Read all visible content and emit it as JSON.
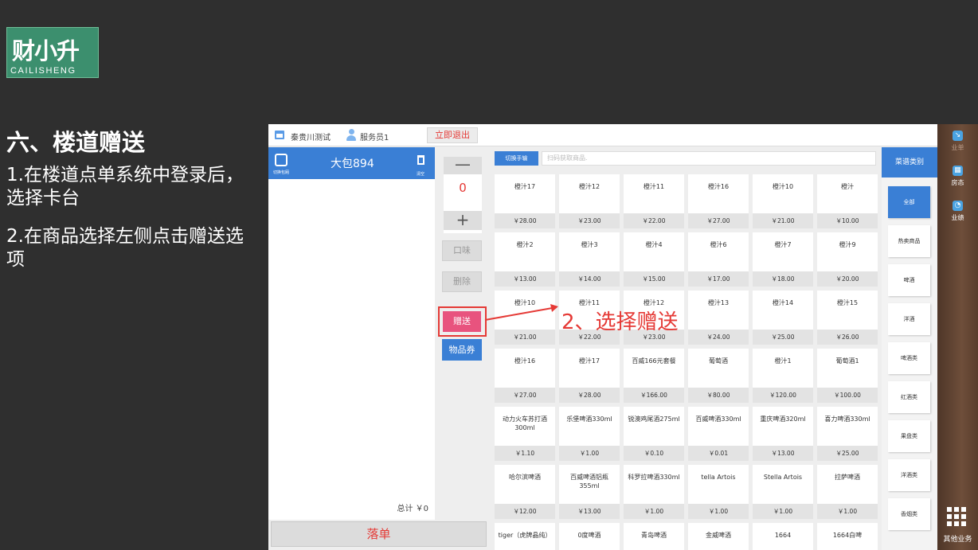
{
  "logo": {
    "cn": "财小升",
    "en": "CAILISHENG"
  },
  "slide": {
    "section_title": "六、楼道赠送",
    "step1": "1.在楼道点单系统中登录后，选择卡台",
    "step2": "2.在商品选择左侧点击赠送选项"
  },
  "app": {
    "store": "秦贵川测试",
    "waiter": "服务员1",
    "logout": "立即退出",
    "switch_table": "切换包厢",
    "table_name": "大包894",
    "clear": "清空",
    "total": "总计 ￥0",
    "place_order": "落单",
    "qty_minus": "—",
    "qty_value": "0",
    "qty_plus": "+",
    "taste": "口味",
    "delete": "删除",
    "gift": "赠送",
    "voucher": "物品券",
    "hand_mode": "切换手输",
    "search_placeholder": "扫码获取商品.",
    "annotation": "2、选择赠送",
    "category_header": "菜谱类别",
    "categories": [
      "全部",
      "热卖商品",
      "啤酒",
      "洋酒",
      "啤酒类",
      "红酒类",
      "果盘类",
      "洋酒类",
      "香烟类"
    ],
    "products": [
      {
        "name": "橙汁17",
        "price": "￥28.00"
      },
      {
        "name": "橙汁12",
        "price": "￥23.00"
      },
      {
        "name": "橙汁11",
        "price": "￥22.00"
      },
      {
        "name": "橙汁16",
        "price": "￥27.00"
      },
      {
        "name": "橙汁10",
        "price": "￥21.00"
      },
      {
        "name": "橙汁",
        "price": "￥10.00"
      },
      {
        "name": "橙汁2",
        "price": "￥13.00"
      },
      {
        "name": "橙汁3",
        "price": "￥14.00"
      },
      {
        "name": "橙汁4",
        "price": "￥15.00"
      },
      {
        "name": "橙汁6",
        "price": "￥17.00"
      },
      {
        "name": "橙汁7",
        "price": "￥18.00"
      },
      {
        "name": "橙汁9",
        "price": "￥20.00"
      },
      {
        "name": "橙汁10",
        "price": "￥21.00"
      },
      {
        "name": "橙汁11",
        "price": "￥22.00"
      },
      {
        "name": "橙汁12",
        "price": "￥23.00"
      },
      {
        "name": "橙汁13",
        "price": "￥24.00"
      },
      {
        "name": "橙汁14",
        "price": "￥25.00"
      },
      {
        "name": "橙汁15",
        "price": "￥26.00"
      },
      {
        "name": "橙汁16",
        "price": "￥27.00"
      },
      {
        "name": "橙汁17",
        "price": "￥28.00"
      },
      {
        "name": "百威166元套餐",
        "price": "￥166.00"
      },
      {
        "name": "葡萄酒",
        "price": "￥80.00"
      },
      {
        "name": "橙汁1",
        "price": "￥120.00"
      },
      {
        "name": "葡萄酒1",
        "price": "￥100.00"
      },
      {
        "name": "动力火车苏打酒300ml",
        "price": "￥1.10"
      },
      {
        "name": "乐堡啤酒330ml",
        "price": "￥1.00"
      },
      {
        "name": "锐澳鸡尾酒275ml",
        "price": "￥0.10"
      },
      {
        "name": "百威啤酒330ml",
        "price": "￥0.01"
      },
      {
        "name": "重庆啤酒320ml",
        "price": "￥13.00"
      },
      {
        "name": "喜力啤酒330ml",
        "price": "￥25.00"
      },
      {
        "name": "哈尔滨啤酒",
        "price": "￥12.00"
      },
      {
        "name": "百威啤酒铝瓶355ml",
        "price": "￥13.00"
      },
      {
        "name": "科罗拉啤酒330ml",
        "price": "￥1.00"
      },
      {
        "name": "tella Artois",
        "price": "￥1.00"
      },
      {
        "name": "Stella Artois",
        "price": "￥1.00"
      },
      {
        "name": "拉萨啤酒",
        "price": "￥1.00"
      },
      {
        "name": "tiger（虎牌晶纯）",
        "price": ""
      },
      {
        "name": "0度啤酒",
        "price": ""
      },
      {
        "name": "青岛啤酒",
        "price": ""
      },
      {
        "name": "金威啤酒",
        "price": ""
      },
      {
        "name": "1664",
        "price": ""
      },
      {
        "name": "1664白啤",
        "price": ""
      }
    ]
  },
  "sidebar": {
    "items": [
      {
        "label": "业单",
        "icon": "chart-icon"
      },
      {
        "label": "房态",
        "icon": "rooms-icon"
      },
      {
        "label": "业绩",
        "icon": "performance-icon"
      }
    ],
    "other": "其他业务"
  }
}
